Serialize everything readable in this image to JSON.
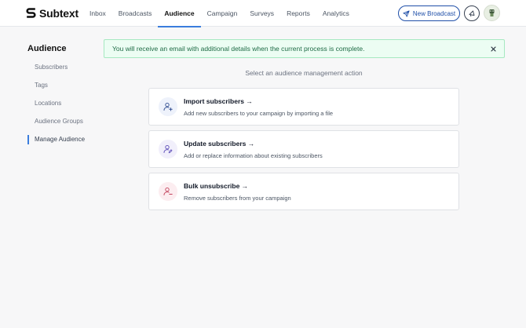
{
  "app": {
    "name": "Subtext"
  },
  "nav": {
    "items": [
      {
        "label": "Inbox",
        "active": false
      },
      {
        "label": "Broadcasts",
        "active": false
      },
      {
        "label": "Audience",
        "active": true
      },
      {
        "label": "Campaign",
        "active": false
      },
      {
        "label": "Surveys",
        "active": false
      },
      {
        "label": "Reports",
        "active": false
      },
      {
        "label": "Analytics",
        "active": false
      }
    ],
    "new_broadcast_label": "New Broadcast"
  },
  "sidebar": {
    "title": "Audience",
    "items": [
      {
        "label": "Subscribers",
        "active": false
      },
      {
        "label": "Tags",
        "active": false
      },
      {
        "label": "Locations",
        "active": false
      },
      {
        "label": "Audience Groups",
        "active": false
      },
      {
        "label": "Manage Audience",
        "active": true
      }
    ]
  },
  "alert": {
    "message": "You will receive an email with additional details when the current process is complete."
  },
  "main": {
    "prompt": "Select an audience management action",
    "actions": [
      {
        "title": "Import subscribers →",
        "description": "Add new subscribers to your campaign by importing a file",
        "icon": "user-plus-icon"
      },
      {
        "title": "Update subscribers →",
        "description": "Add or replace information about existing subscribers",
        "icon": "user-edit-icon"
      },
      {
        "title": "Bulk unsubscribe →",
        "description": "Remove subscribers from your campaign",
        "icon": "user-minus-icon"
      }
    ]
  },
  "colors": {
    "accent": "#3b7ddd",
    "brand_blue": "#1f4fa8",
    "alert_bg": "#ecfdf3",
    "alert_text": "#1e6b45",
    "danger": "#c2415b",
    "purple": "#5b4bb7"
  }
}
